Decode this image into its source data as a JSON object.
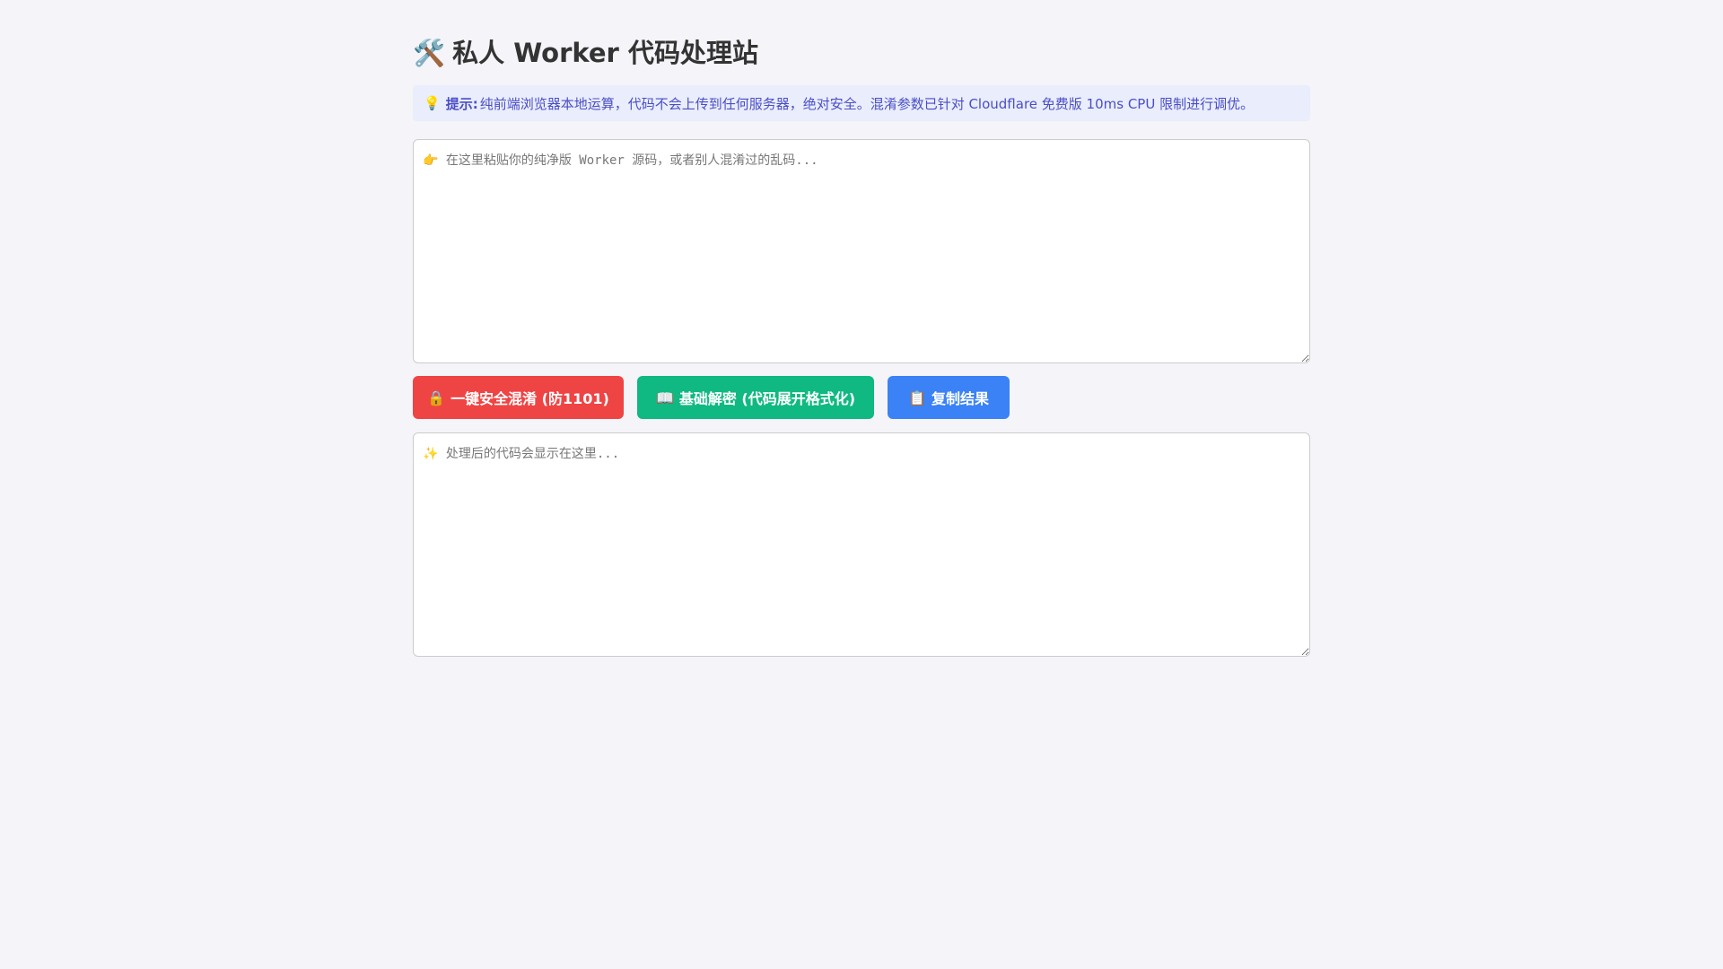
{
  "header": {
    "icon": "🛠️",
    "title": "私人 Worker 代码处理站"
  },
  "tip": {
    "icon": "💡",
    "label": "提示:",
    "text": "纯前端浏览器本地运算，代码不会上传到任何服务器，绝对安全。混淆参数已针对 Cloudflare 免费版 10ms CPU 限制进行调优。"
  },
  "input": {
    "placeholder": "👉 在这里粘贴你的纯净版 Worker 源码，或者别人混淆过的乱码...",
    "value": ""
  },
  "actions": {
    "obfuscate": {
      "icon": "🔒",
      "label": "一键安全混淆 (防1101)",
      "color": "#ef4444"
    },
    "decode": {
      "icon": "📖",
      "label": "基础解密 (代码展开格式化)",
      "color": "#10b981"
    },
    "copy": {
      "icon": "📋",
      "label": "复制结果",
      "color": "#3b82f6"
    }
  },
  "output": {
    "placeholder": "✨ 处理后的代码会显示在这里...",
    "value": ""
  },
  "colors": {
    "background": "#f4f4f9",
    "tip_background": "#eaedfb",
    "tip_text": "#4a4ec7"
  }
}
